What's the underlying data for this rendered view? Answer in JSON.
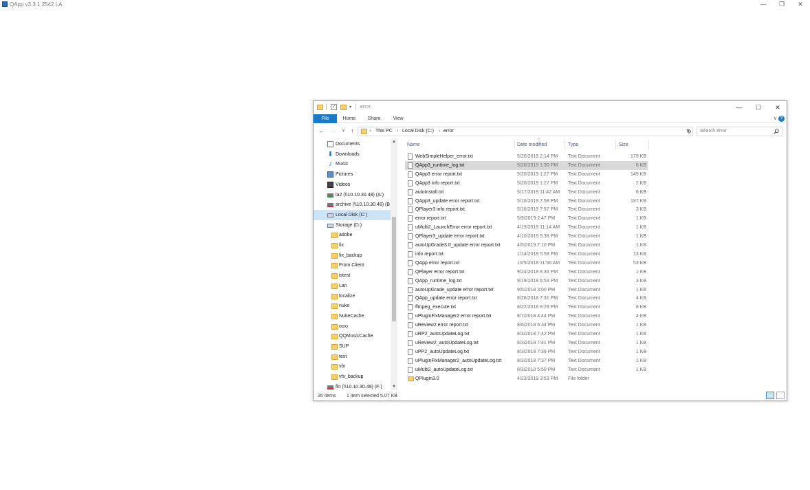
{
  "app": {
    "title": "QApp v3.3.1.2542 LA",
    "controls": {
      "minimize": "—",
      "restore": "❐",
      "close": "✕"
    }
  },
  "explorer": {
    "title": "error",
    "controls": {
      "minimize": "—",
      "maximize": "☐",
      "close": "✕"
    },
    "ribbon_tabs": [
      "File",
      "Home",
      "Share",
      "View"
    ],
    "nav": {
      "back": "←",
      "forward": "→",
      "recent": "∨",
      "up": "↑",
      "refresh": "↻"
    },
    "breadcrumb": [
      "This PC",
      "Local Disk (C:)",
      "error"
    ],
    "search_placeholder": "Search error",
    "nav_pane": [
      {
        "label": "Documents",
        "icon": "documents-icon"
      },
      {
        "label": "Downloads",
        "icon": "downloads-icon"
      },
      {
        "label": "Music",
        "icon": "music-icon"
      },
      {
        "label": "Pictures",
        "icon": "pictures-icon"
      },
      {
        "label": "Videos",
        "icon": "videos-icon"
      },
      {
        "label": "la2 (\\\\10.10.30.48) (A:)",
        "icon": "network-drive-icon"
      },
      {
        "label": "archive (\\\\10.10.30.48) (B",
        "icon": "network-drive-disconnected-icon"
      },
      {
        "label": "Local Disk (C:)",
        "icon": "local-disk-icon",
        "selected": true
      },
      {
        "label": "Storage (D:)",
        "icon": "local-disk-icon"
      },
      {
        "label": "adobe",
        "icon": "folder-icon"
      },
      {
        "label": "fix",
        "icon": "folder-icon"
      },
      {
        "label": "fix_backup",
        "icon": "folder-icon"
      },
      {
        "label": "From Client",
        "icon": "folder-icon"
      },
      {
        "label": "istest",
        "icon": "folder-icon"
      },
      {
        "label": "Lan",
        "icon": "folder-icon"
      },
      {
        "label": "localize",
        "icon": "folder-icon"
      },
      {
        "label": "nuke",
        "icon": "folder-icon"
      },
      {
        "label": "NukeCache",
        "icon": "folder-icon"
      },
      {
        "label": "ocio",
        "icon": "folder-icon"
      },
      {
        "label": "QQMusicCache",
        "icon": "folder-icon"
      },
      {
        "label": "SUP",
        "icon": "folder-icon"
      },
      {
        "label": "test",
        "icon": "folder-icon"
      },
      {
        "label": "vfx",
        "icon": "folder-icon"
      },
      {
        "label": "vfx_backup",
        "icon": "folder-icon"
      },
      {
        "label": "fkt (\\\\10.10.30.49) (F:)",
        "icon": "network-drive-disconnected-icon"
      }
    ],
    "columns": [
      "Name",
      "Date modified",
      "Type",
      "Size"
    ],
    "files": [
      {
        "name": "WebSimpleHelper_error.txt",
        "date": "5/20/2019 2:14 PM",
        "type": "Text Document",
        "size": "179 KB"
      },
      {
        "name": "QApp3_runtime_log.txt",
        "date": "5/20/2019 1:30 PM",
        "type": "Text Document",
        "size": "6 KB",
        "selected": true
      },
      {
        "name": "QApp3 error report.txt",
        "date": "5/20/2019 1:27 PM",
        "type": "Text Document",
        "size": "149 KB"
      },
      {
        "name": "QApp3 info report.txt",
        "date": "5/20/2019 1:27 PM",
        "type": "Text Document",
        "size": "2 KB"
      },
      {
        "name": "autoInstall.txt",
        "date": "5/17/2019 11:42 AM",
        "type": "Text Document",
        "size": "6 KB"
      },
      {
        "name": "QApp3_update error report.txt",
        "date": "5/16/2019 7:58 PM",
        "type": "Text Document",
        "size": "187 KB"
      },
      {
        "name": "QPlayer3 info report.txt",
        "date": "5/16/2019 7:57 PM",
        "type": "Text Document",
        "size": "3 KB"
      },
      {
        "name": " error report.txt",
        "date": "5/9/2019 2:47 PM",
        "type": "Text Document",
        "size": "1 KB"
      },
      {
        "name": "uMulti2_LaunchError error report.txt",
        "date": "4/19/2019 11:14 AM",
        "type": "Text Document",
        "size": "1 KB"
      },
      {
        "name": "QPlayer3_update error report.txt",
        "date": "4/10/2019 5:38 PM",
        "type": "Text Document",
        "size": "1 KB"
      },
      {
        "name": "autoUpGrade3.0_update error report.txt",
        "date": "4/5/2019 7:10 PM",
        "type": "Text Document",
        "size": "1 KB"
      },
      {
        "name": " info report.txt",
        "date": "1/14/2019 5:58 PM",
        "type": "Text Document",
        "size": "13 KB"
      },
      {
        "name": "QApp error report.txt",
        "date": "10/5/2018 11:56 AM",
        "type": "Text Document",
        "size": "53 KB"
      },
      {
        "name": "QPlayer error report.txt",
        "date": "9/24/2018 8:36 PM",
        "type": "Text Document",
        "size": "1 KB"
      },
      {
        "name": "QApp_runtime_log.txt",
        "date": "9/19/2018 6:53 PM",
        "type": "Text Document",
        "size": "3 KB"
      },
      {
        "name": "autoUpGrade_update error report.txt",
        "date": "9/5/2018 3:00 PM",
        "type": "Text Document",
        "size": "1 KB"
      },
      {
        "name": "QApp_update error report.txt",
        "date": "8/28/2018 7:31 PM",
        "type": "Text Document",
        "size": "4 KB"
      },
      {
        "name": "ffmpeg_execute.txt",
        "date": "8/22/2018 8:29 PM",
        "type": "Text Document",
        "size": "8 KB"
      },
      {
        "name": "uPluginFixManager2 error report.txt",
        "date": "8/7/2018 4:44 PM",
        "type": "Text Document",
        "size": "4 KB"
      },
      {
        "name": "uReview2 error report.txt",
        "date": "8/6/2018 5:34 PM",
        "type": "Text Document",
        "size": "1 KB"
      },
      {
        "name": "uRP2_autoUpdateLog.txt",
        "date": "8/3/2018 7:42 PM",
        "type": "Text Document",
        "size": "1 KB"
      },
      {
        "name": "uReview2_autoUpdateLog.txt",
        "date": "8/3/2018 7:41 PM",
        "type": "Text Document",
        "size": "1 KB"
      },
      {
        "name": "uPP2_autoUpdateLog.txt",
        "date": "8/3/2018 7:39 PM",
        "type": "Text Document",
        "size": "1 KB"
      },
      {
        "name": "uPluginFixManager2_autoUpdateLog.txt",
        "date": "8/3/2018 7:37 PM",
        "type": "Text Document",
        "size": "1 KB"
      },
      {
        "name": "uMulti2_autoUpdateLog.txt",
        "date": "8/3/2018 5:50 PM",
        "type": "Text Document",
        "size": "1 KB"
      },
      {
        "name": "QPlugin3.0",
        "date": "4/23/2019 3:53 PM",
        "type": "File folder",
        "size": "",
        "folder": true
      }
    ],
    "status": {
      "item_count": "26 items",
      "selection": "1 item selected  5.07 KB"
    }
  }
}
